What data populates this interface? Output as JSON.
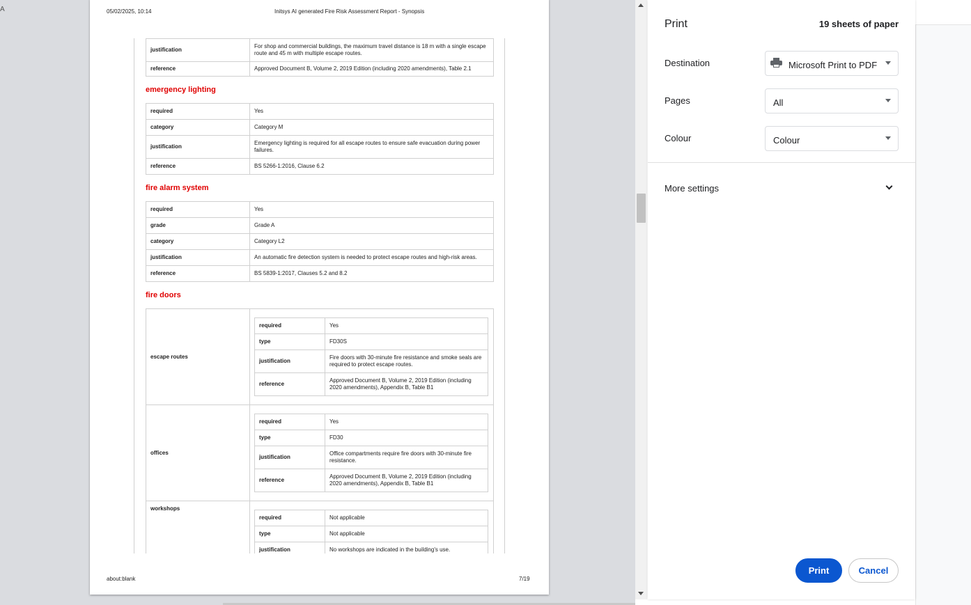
{
  "preview": {
    "corner_mark": "A",
    "header_date": "05/02/2025, 10:14",
    "header_title": "Initsys AI generated Fire Risk Assessment Report - Synopsis",
    "footer_url": "about:blank",
    "footer_page": "7/19",
    "top_table": [
      {
        "key": "justification",
        "value": "For shop and commercial buildings, the maximum travel distance is 18 m with a single escape route and 45 m with multiple escape routes."
      },
      {
        "key": "reference",
        "value": "Approved Document B, Volume 2, 2019 Edition (including 2020 amendments), Table 2.1"
      }
    ],
    "emergency_lighting": {
      "title": "emergency lighting",
      "rows": [
        {
          "key": "required",
          "value": "Yes"
        },
        {
          "key": "category",
          "value": "Category M"
        },
        {
          "key": "justification",
          "value": "Emergency lighting is required for all escape routes to ensure safe evacuation during power failures."
        },
        {
          "key": "reference",
          "value": "BS 5266-1:2016, Clause 6.2"
        }
      ]
    },
    "fire_alarm": {
      "title": "fire alarm system",
      "rows": [
        {
          "key": "required",
          "value": "Yes"
        },
        {
          "key": "grade",
          "value": "Grade A"
        },
        {
          "key": "category",
          "value": "Category L2"
        },
        {
          "key": "justification",
          "value": "An automatic fire detection system is needed to protect escape routes and high-risk areas."
        },
        {
          "key": "reference",
          "value": "BS 5839-1:2017, Clauses 5.2 and 8.2"
        }
      ]
    },
    "fire_doors": {
      "title": "fire doors",
      "groups": [
        {
          "name": "escape routes",
          "rows": [
            {
              "key": "required",
              "value": "Yes"
            },
            {
              "key": "type",
              "value": "FD30S"
            },
            {
              "key": "justification",
              "value": "Fire doors with 30-minute fire resistance and smoke seals are required to protect escape routes."
            },
            {
              "key": "reference",
              "value": "Approved Document B, Volume 2, 2019 Edition (including 2020 amendments), Appendix B, Table B1"
            }
          ]
        },
        {
          "name": "offices",
          "rows": [
            {
              "key": "required",
              "value": "Yes"
            },
            {
              "key": "type",
              "value": "FD30"
            },
            {
              "key": "justification",
              "value": "Office compartments require fire doors with 30-minute fire resistance."
            },
            {
              "key": "reference",
              "value": "Approved Document B, Volume 2, 2019 Edition (including 2020 amendments), Appendix B, Table B1"
            }
          ]
        },
        {
          "name": "workshops",
          "rows": [
            {
              "key": "required",
              "value": "Not applicable"
            },
            {
              "key": "type",
              "value": "Not applicable"
            },
            {
              "key": "justification",
              "value": "No workshops are indicated in the building's use."
            }
          ]
        }
      ]
    }
  },
  "panel": {
    "title": "Print",
    "sheets": "19 sheets of paper",
    "destination_label": "Destination",
    "destination_value": "Microsoft Print to PDF",
    "destination_icon": "printer-icon",
    "pages_label": "Pages",
    "pages_value": "All",
    "colour_label": "Colour",
    "colour_value": "Colour",
    "more_settings": "More settings",
    "print_button": "Print",
    "cancel_button": "Cancel",
    "accent_color": "#0b57d0"
  }
}
